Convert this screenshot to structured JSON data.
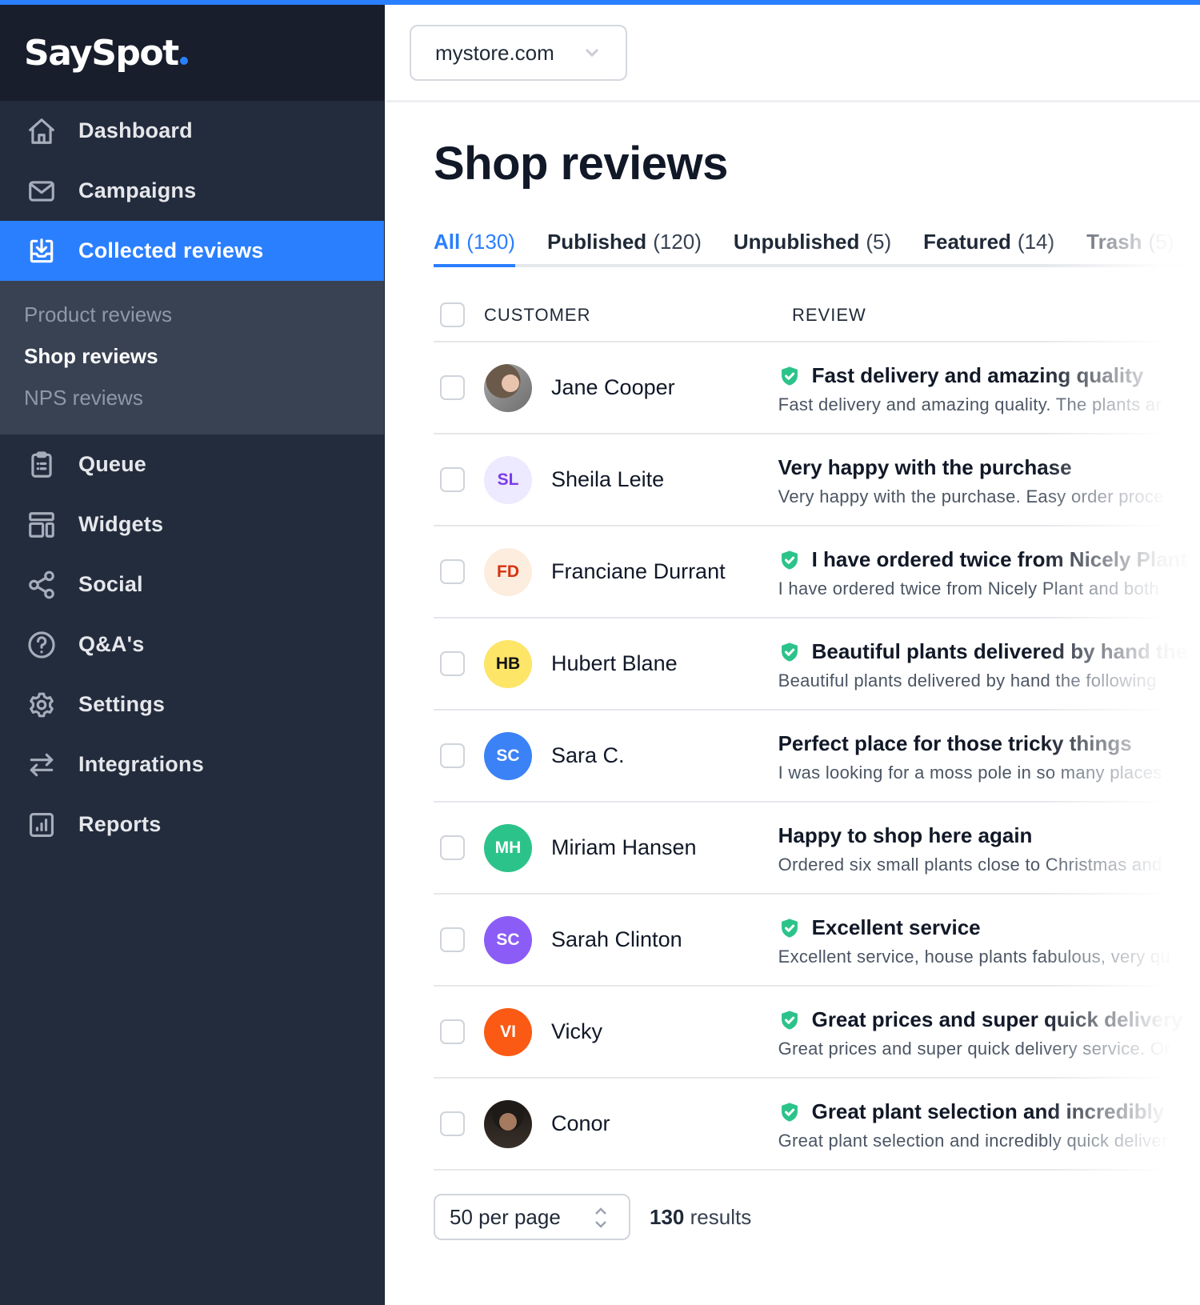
{
  "app": {
    "logo_text": "SaySpot",
    "accent_color": "#2a7fff"
  },
  "sidebar": {
    "items_top": [
      {
        "label": "Dashboard",
        "icon": "home-icon"
      },
      {
        "label": "Campaigns",
        "icon": "mail-icon"
      },
      {
        "label": "Collected reviews",
        "icon": "inbox-download-icon",
        "active": true
      }
    ],
    "submenu": [
      {
        "label": "Product reviews"
      },
      {
        "label": "Shop reviews",
        "active": true
      },
      {
        "label": "NPS reviews"
      }
    ],
    "items_bottom": [
      {
        "label": "Queue",
        "icon": "clipboard-icon"
      },
      {
        "label": "Widgets",
        "icon": "layout-icon"
      },
      {
        "label": "Social",
        "icon": "share-icon"
      },
      {
        "label": "Q&A's",
        "icon": "question-icon"
      },
      {
        "label": "Settings",
        "icon": "gear-icon"
      },
      {
        "label": "Integrations",
        "icon": "arrows-swap-icon"
      },
      {
        "label": "Reports",
        "icon": "bar-chart-icon"
      }
    ]
  },
  "header": {
    "store_select": {
      "value": "mystore.com"
    }
  },
  "page": {
    "title": "Shop reviews"
  },
  "tabs": [
    {
      "label": "All",
      "count": "(130)",
      "active": true
    },
    {
      "label": "Published",
      "count": "(120)"
    },
    {
      "label": "Unpublished",
      "count": "(5)"
    },
    {
      "label": "Featured",
      "count": "(14)"
    },
    {
      "label": "Trash",
      "count": "(5)"
    }
  ],
  "table": {
    "columns": {
      "customer": "CUSTOMER",
      "review": "REVIEW"
    },
    "rows": [
      {
        "name": "Jane Cooper",
        "avatar_type": "photo",
        "initials": "",
        "avatar_bg": "#8a8a8a",
        "avatar_fg": "#ffffff",
        "verified": true,
        "title": "Fast delivery and amazing quality",
        "body": "Fast delivery and amazing quality. The plants ar"
      },
      {
        "name": "Sheila Leite",
        "avatar_type": "initials",
        "initials": "SL",
        "avatar_bg": "#ede9fe",
        "avatar_fg": "#7c3aed",
        "verified": false,
        "title": "Very happy with the purchase",
        "body": "Very happy with the purchase. Easy order proce"
      },
      {
        "name": "Franciane Durrant",
        "avatar_type": "initials",
        "initials": "FD",
        "avatar_bg": "#fdeddf",
        "avatar_fg": "#d5330f",
        "verified": true,
        "title": "I have ordered twice from Nicely Plant",
        "body": "I have ordered twice from Nicely Plant and both"
      },
      {
        "name": "Hubert Blane",
        "avatar_type": "initials",
        "initials": "HB",
        "avatar_bg": "#fde568",
        "avatar_fg": "#111111",
        "verified": true,
        "title": "Beautiful plants delivered by hand the",
        "body": "Beautiful plants delivered by hand the following"
      },
      {
        "name": "Sara C.",
        "avatar_type": "initials",
        "initials": "SC",
        "avatar_bg": "#3b82f6",
        "avatar_fg": "#ffffff",
        "verified": false,
        "title": "Perfect place for those tricky things",
        "body": "I was looking for a moss pole in so many places"
      },
      {
        "name": "Miriam Hansen",
        "avatar_type": "initials",
        "initials": "MH",
        "avatar_bg": "#2cc38a",
        "avatar_fg": "#ffffff",
        "verified": false,
        "title": "Happy to shop here again",
        "body": "Ordered six small plants close to Christmas and"
      },
      {
        "name": "Sarah Clinton",
        "avatar_type": "initials",
        "initials": "SC",
        "avatar_bg": "#8b5cf6",
        "avatar_fg": "#ffffff",
        "verified": true,
        "title": "Excellent service",
        "body": "Excellent service, house plants fabulous, very qu"
      },
      {
        "name": "Vicky",
        "avatar_type": "initials",
        "initials": "VI",
        "avatar_bg": "#fb5a14",
        "avatar_fg": "#ffffff",
        "verified": true,
        "title": "Great prices and super quick delivery",
        "body": "Great prices and super quick delivery service. Or"
      },
      {
        "name": "Conor",
        "avatar_type": "photo",
        "initials": "",
        "avatar_bg": "#2b2622",
        "avatar_fg": "#ffffff",
        "verified": true,
        "title": "Great plant selection and incredibly",
        "body": "Great plant selection and incredibly quick deliver"
      }
    ]
  },
  "footer": {
    "per_page": "50 per page",
    "results_count": "130",
    "results_label": "results"
  },
  "colors": {
    "verified": "#2cc38a"
  }
}
